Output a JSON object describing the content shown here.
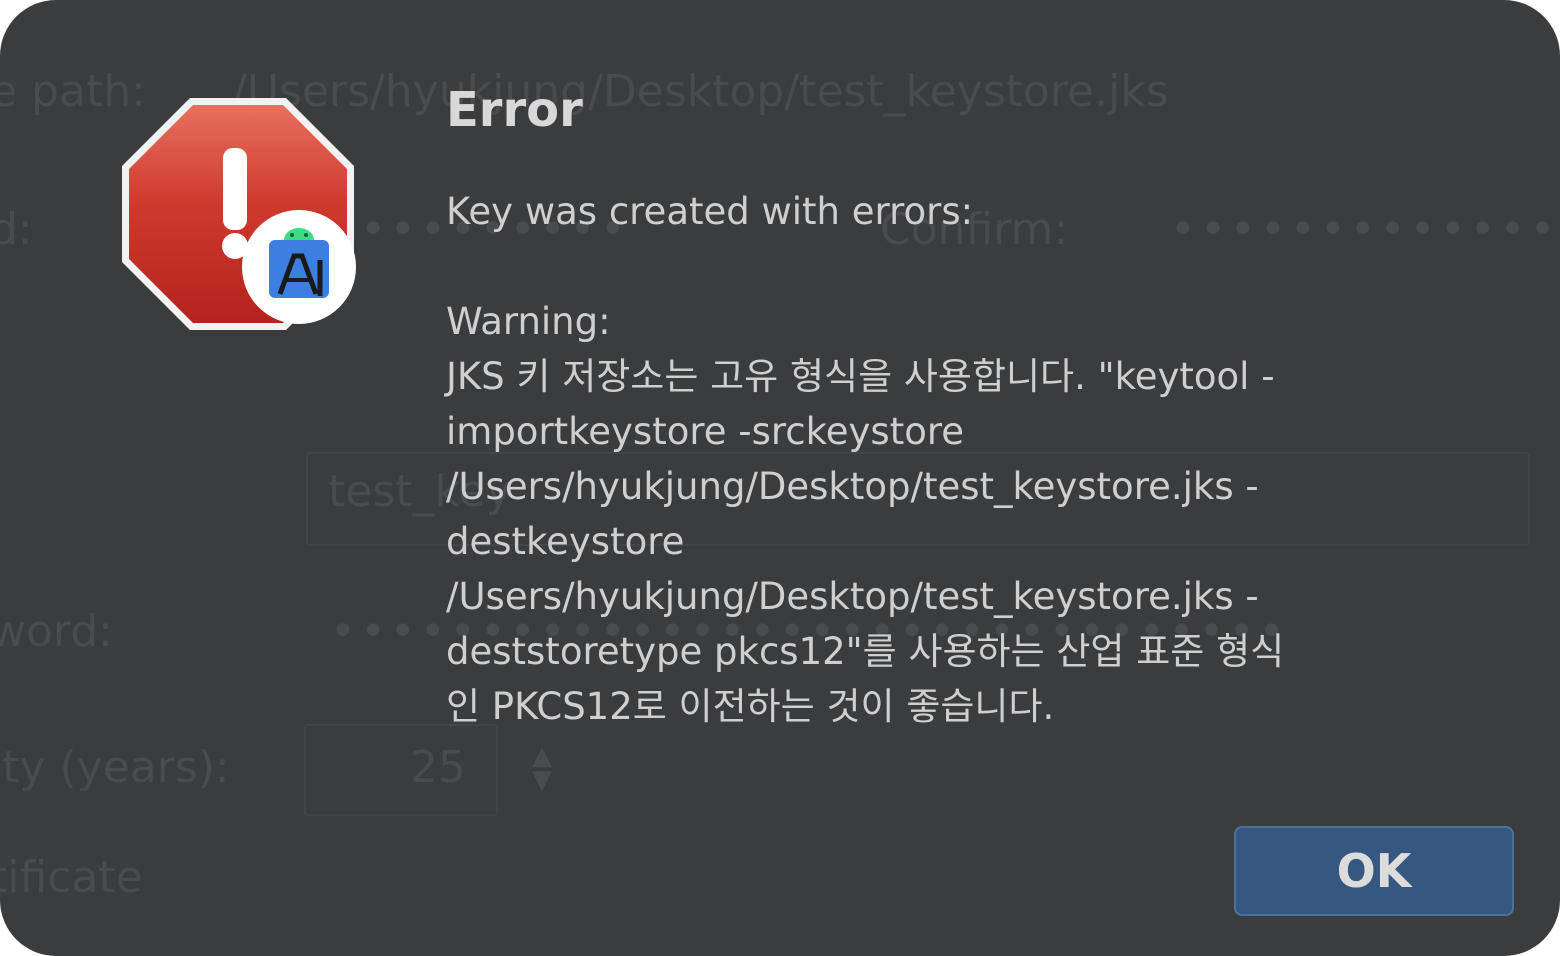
{
  "background_form": {
    "path_label": "e path:",
    "path_value": "/Users/hyukjung/Desktop/test_keystore.jks",
    "password_label": "d:",
    "password_value": "••••••••••",
    "confirm_label": "Confirm:",
    "confirm_value": "•••••••••••••",
    "alias_label": ":",
    "alias_value": "test_key",
    "key_password_label": "word:",
    "key_password_value": "••••••••••••••••••••••••••••••••",
    "validity_label": "ity (years):",
    "validity_value": "25",
    "certificate_label": "tificate"
  },
  "dialog": {
    "icon": "error-stop-sign-icon",
    "badge_icon": "android-studio-icon",
    "title": "Error",
    "message_lines_1": [
      "Key was created with errors:"
    ],
    "message_lines_2": [
      "Warning:",
      "JKS 키 저장소는 고유 형식을 사용합니다. \"keytool -",
      "importkeystore -srckeystore",
      "/Users/hyukjung/Desktop/test_keystore.jks -",
      "destkeystore",
      "/Users/hyukjung/Desktop/test_keystore.jks -",
      "deststoretype pkcs12\"를 사용하는 산업 표준 형식",
      "인 PKCS12로 이전하는 것이 좋습니다."
    ],
    "ok_label": "OK"
  },
  "colors": {
    "dialog_bg": "#3b3c3e",
    "ok_button": "#365880",
    "error_red": "#c8362b"
  }
}
